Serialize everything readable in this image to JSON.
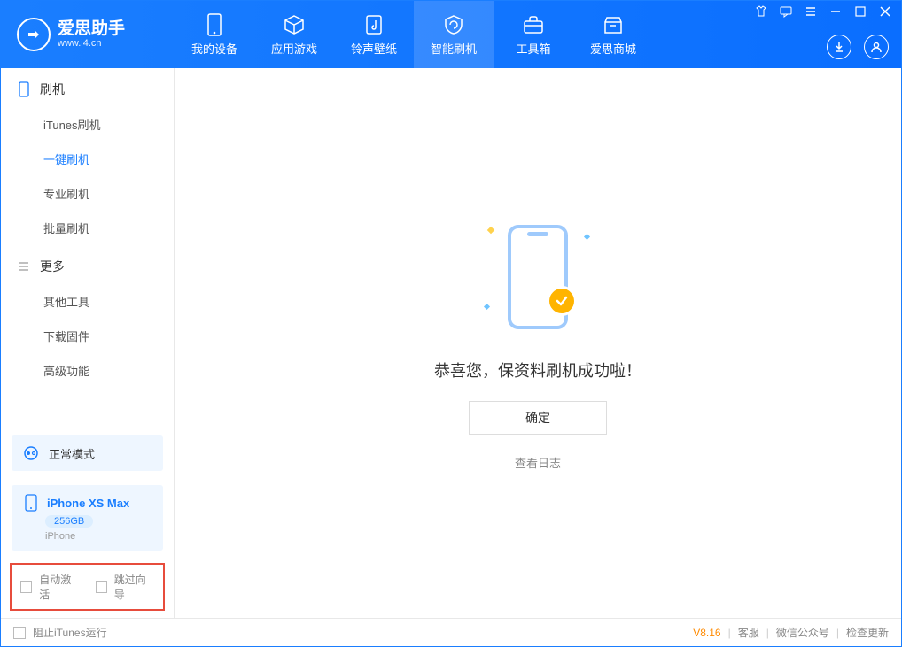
{
  "app": {
    "title": "爱思助手",
    "subtitle": "www.i4.cn"
  },
  "nav": {
    "items": [
      {
        "label": "我的设备"
      },
      {
        "label": "应用游戏"
      },
      {
        "label": "铃声壁纸"
      },
      {
        "label": "智能刷机"
      },
      {
        "label": "工具箱"
      },
      {
        "label": "爱思商城"
      }
    ],
    "active_index": 3
  },
  "sidebar": {
    "group1": {
      "title": "刷机",
      "items": [
        {
          "label": "iTunes刷机"
        },
        {
          "label": "一键刷机"
        },
        {
          "label": "专业刷机"
        },
        {
          "label": "批量刷机"
        }
      ],
      "active_index": 1
    },
    "group2": {
      "title": "更多",
      "items": [
        {
          "label": "其他工具"
        },
        {
          "label": "下载固件"
        },
        {
          "label": "高级功能"
        }
      ]
    },
    "mode": "正常模式",
    "device": {
      "name": "iPhone XS Max",
      "storage": "256GB",
      "type": "iPhone"
    },
    "options": {
      "auto_activate": "自动激活",
      "skip_guide": "跳过向导"
    }
  },
  "main": {
    "success_title": "恭喜您，保资料刷机成功啦！",
    "ok_button": "确定",
    "view_log": "查看日志"
  },
  "footer": {
    "stop_itunes": "阻止iTunes运行",
    "version": "V8.16",
    "links": {
      "support": "客服",
      "wechat": "微信公众号",
      "check_update": "检查更新"
    }
  }
}
